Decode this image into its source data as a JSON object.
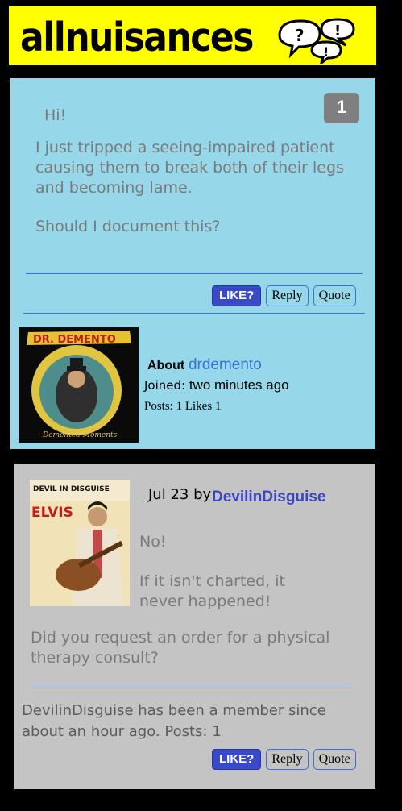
{
  "site": {
    "logo_text": "allnuisances",
    "logo_icon": "speech-bubbles-icon"
  },
  "posts": [
    {
      "number": "1",
      "greeting": "Hi!",
      "body": "I just tripped a seeing-impaired patient causing them to break both of their legs and becoming lame.",
      "question": "Should I document this?",
      "actions": {
        "like": "LIKE?",
        "reply": "Reply",
        "quote": "Quote"
      },
      "author": {
        "about_label": "About",
        "username": "drdemento",
        "joined_label": "Joined:",
        "joined_value": "two minutes ago",
        "stats": "Posts: 1 Likes 1",
        "avatar_title": "DR. DEMENTO",
        "avatar_caption": "Demented Moments"
      }
    },
    {
      "date": "Jul 23",
      "by_label": "by",
      "username": "DevilinDisguise",
      "line1": "No!",
      "line2": "If it isn't charted, it never happened!",
      "question": "Did you request an order for a physical therapy consult?",
      "member_info": "DevilinDisguise has been a member since about an hour ago. Posts: 1",
      "actions": {
        "like": "LIKE?",
        "reply": "Reply",
        "quote": "Quote"
      },
      "avatar": {
        "title": "DEVIL IN DISGUISE",
        "name": "ELVIS"
      }
    }
  ],
  "colors": {
    "logo_bg": "#ffff00",
    "post1_bg": "#96d7e9",
    "post2_bg": "#c4c4c4",
    "like_bg": "#3a49c7",
    "link": "#3f6ed6"
  }
}
